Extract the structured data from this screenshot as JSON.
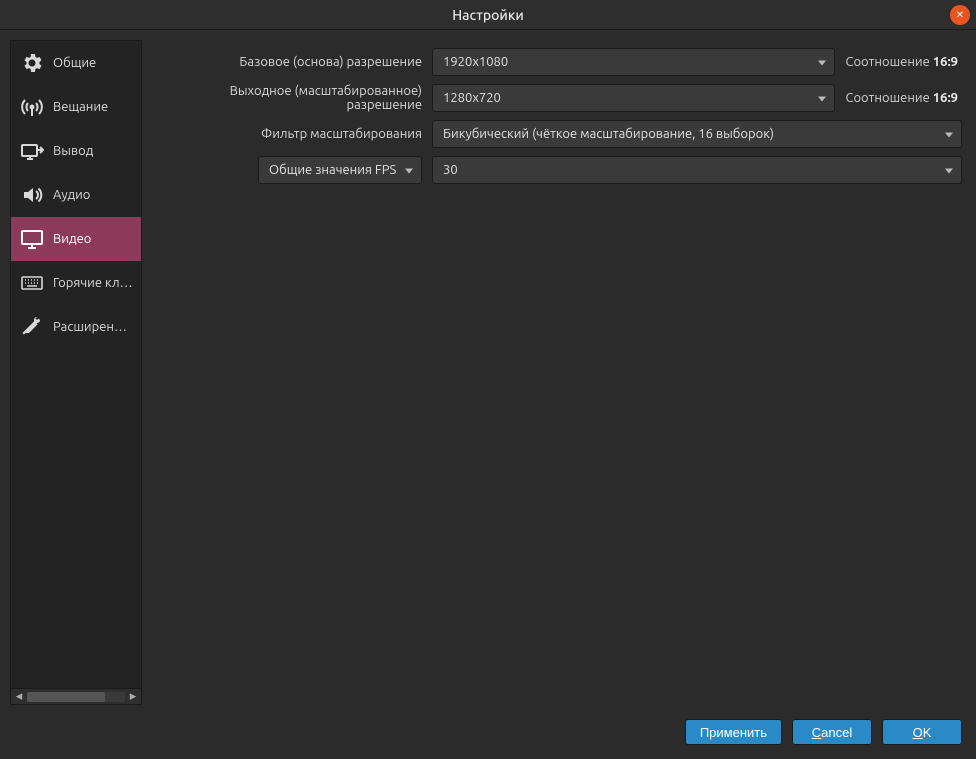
{
  "title": "Настройки",
  "sidebar": {
    "items": [
      {
        "id": "general",
        "label": "Общие",
        "icon": "gear-icon"
      },
      {
        "id": "stream",
        "label": "Вещание",
        "icon": "antenna-icon"
      },
      {
        "id": "output",
        "label": "Вывод",
        "icon": "output-icon"
      },
      {
        "id": "audio",
        "label": "Аудио",
        "icon": "speaker-icon"
      },
      {
        "id": "video",
        "label": "Видео",
        "icon": "monitor-icon",
        "active": true
      },
      {
        "id": "hotkeys",
        "label": "Горячие клавиши",
        "icon": "keyboard-icon"
      },
      {
        "id": "advanced",
        "label": "Расширенные",
        "icon": "tools-icon"
      }
    ]
  },
  "video": {
    "base_label": "Базовое (основа) разрешение",
    "base_value": "1920x1080",
    "base_aspect_label": "Соотношение",
    "base_aspect_value": "16:9",
    "output_label": "Выходное (масштабированное) разрешение",
    "output_value": "1280x720",
    "output_aspect_label": "Соотношение",
    "output_aspect_value": "16:9",
    "filter_label": "Фильтр масштабирования",
    "filter_value": "Бикубический (чёткое масштабирование, 16 выборок)",
    "fps_type_label": "Общие значения FPS",
    "fps_value": "30"
  },
  "buttons": {
    "apply": "Применить",
    "cancel": "Cancel",
    "ok": "OK"
  }
}
